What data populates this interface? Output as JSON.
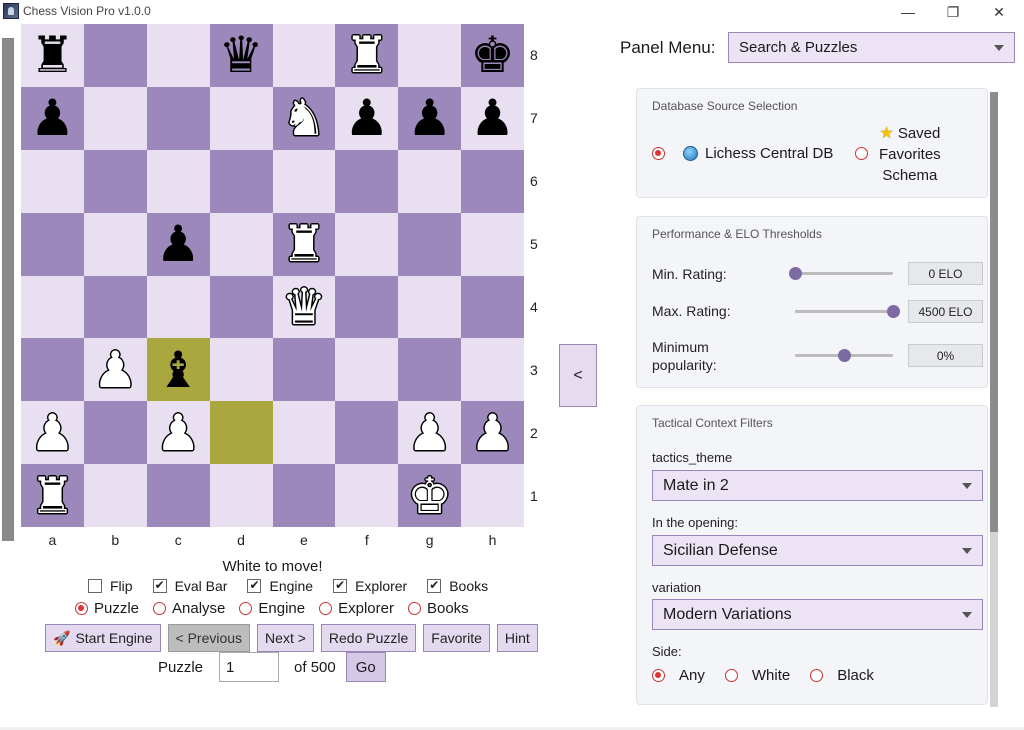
{
  "window": {
    "title": "Chess Vision Pro v1.0.0",
    "min": "—",
    "max": "❐",
    "close": "✕"
  },
  "board": {
    "ranks": [
      "8",
      "7",
      "6",
      "5",
      "4",
      "3",
      "2",
      "1"
    ],
    "files": [
      "a",
      "b",
      "c",
      "d",
      "e",
      "f",
      "g",
      "h"
    ],
    "rows": [
      [
        [
          "r",
          "b"
        ],
        null,
        null,
        [
          "q",
          "b"
        ],
        null,
        [
          "r",
          "w"
        ],
        null,
        [
          "k",
          "b"
        ]
      ],
      [
        [
          "p",
          "b"
        ],
        null,
        null,
        null,
        [
          "n",
          "w"
        ],
        [
          "p",
          "b"
        ],
        [
          "p",
          "b"
        ],
        [
          "p",
          "b"
        ]
      ],
      [
        null,
        null,
        null,
        null,
        null,
        null,
        null,
        null
      ],
      [
        null,
        null,
        [
          "p",
          "b"
        ],
        null,
        [
          "r",
          "w"
        ],
        null,
        null,
        null
      ],
      [
        null,
        null,
        null,
        null,
        [
          "q",
          "w"
        ],
        null,
        null,
        null
      ],
      [
        null,
        [
          "p",
          "w"
        ],
        [
          "b",
          "b"
        ],
        null,
        null,
        null,
        null,
        null
      ],
      [
        [
          "p",
          "w"
        ],
        null,
        [
          "p",
          "w"
        ],
        null,
        null,
        null,
        [
          "p",
          "w"
        ],
        [
          "p",
          "w"
        ]
      ],
      [
        [
          "r",
          "w"
        ],
        null,
        null,
        null,
        null,
        null,
        [
          "k",
          "w"
        ],
        null
      ]
    ],
    "highlights": [
      "c3",
      "d2"
    ]
  },
  "controls": {
    "to_move": "White to move!",
    "collapse": "<",
    "checks": [
      {
        "label": "Flip",
        "checked": false
      },
      {
        "label": "Eval Bar",
        "checked": true
      },
      {
        "label": "Engine",
        "checked": true
      },
      {
        "label": "Explorer",
        "checked": true
      },
      {
        "label": "Books",
        "checked": true
      }
    ],
    "modes": [
      {
        "label": "Puzzle",
        "selected": true
      },
      {
        "label": "Analyse",
        "selected": false
      },
      {
        "label": "Engine",
        "selected": false
      },
      {
        "label": "Explorer",
        "selected": false
      },
      {
        "label": "Books",
        "selected": false
      }
    ],
    "buttons": {
      "start_engine": "Start Engine",
      "previous": "< Previous",
      "next": "Next >",
      "redo": "Redo Puzzle",
      "favorite": "Favorite",
      "hint": "Hint"
    },
    "puzzle_label": "Puzzle",
    "puzzle_value": "1",
    "of_label": "of 500",
    "go": "Go"
  },
  "panel": {
    "menu_label": "Panel Menu:",
    "menu_value": "Search & Puzzles",
    "db": {
      "title": "Database Source Selection",
      "option1": "Lichess Central DB",
      "option2_line1": "Saved",
      "option2_line2": "Favorites",
      "option2_line3": "Schema"
    },
    "perf": {
      "title": "Performance & ELO Thresholds",
      "min_label": "Min. Rating:",
      "min_value": "0 ELO",
      "max_label": "Max. Rating:",
      "max_value": "4500 ELO",
      "pop_label1": "Minimum",
      "pop_label2": "popularity:",
      "pop_value": "0%"
    },
    "tactical": {
      "title": "Tactical Context Filters",
      "theme_label": "tactics_theme",
      "theme_value": "Mate in 2",
      "opening_label": "In the opening:",
      "opening_value": "Sicilian Defense",
      "variation_label": "variation",
      "variation_value": "Modern Variations",
      "side_label": "Side:",
      "sides": [
        {
          "label": "Any",
          "selected": true
        },
        {
          "label": "White",
          "selected": false
        },
        {
          "label": "Black",
          "selected": false
        }
      ]
    },
    "sliders": {
      "min_fraction": 0.0,
      "max_fraction": 1.0,
      "pop_fraction": 0.5
    }
  }
}
